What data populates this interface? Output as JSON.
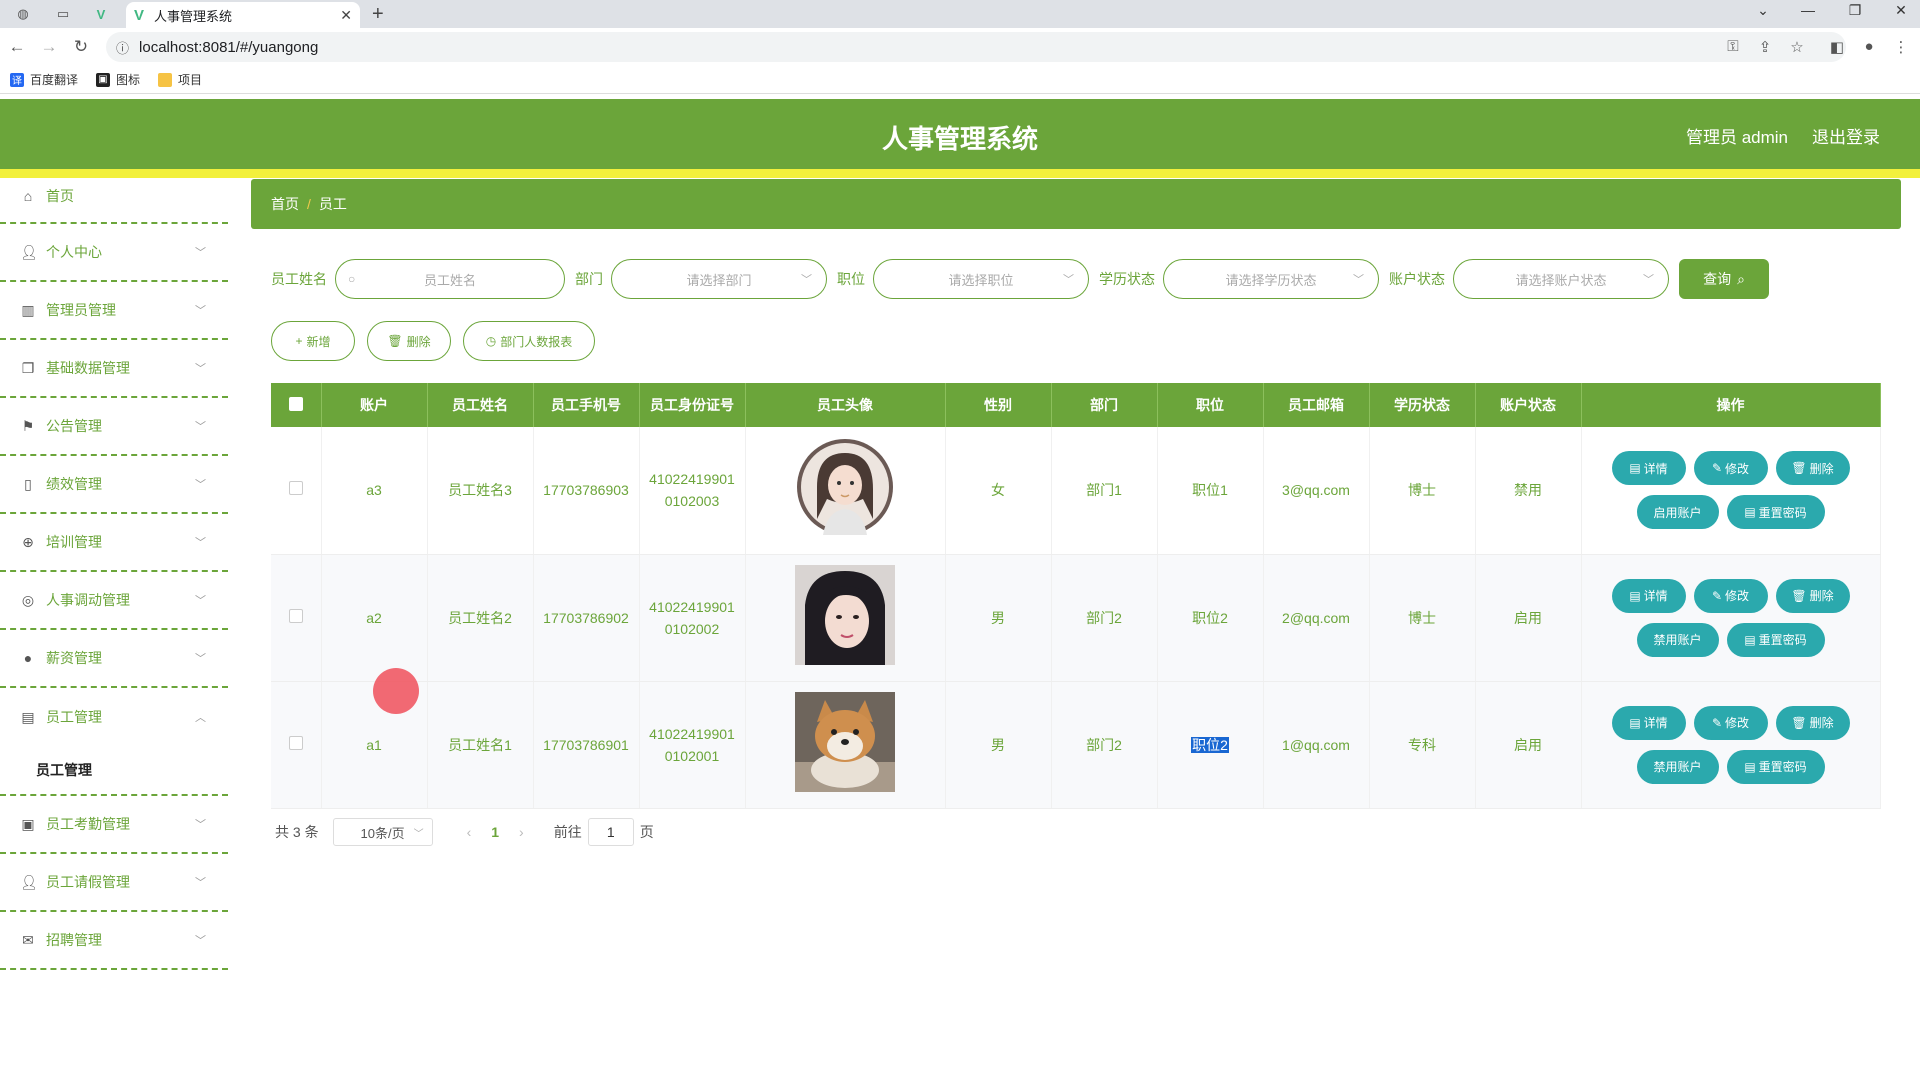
{
  "browser": {
    "tab_title": "人事管理系统",
    "url": "localhost:8081/#/yuangong",
    "bookmarks": [
      {
        "label": "百度翻译",
        "color": "#2468f2"
      },
      {
        "label": "图标",
        "color": "#222222"
      },
      {
        "label": "项目",
        "color": "#f6c344"
      }
    ]
  },
  "header": {
    "title": "人事管理系统",
    "admin_label": "管理员 admin",
    "logout_label": "退出登录"
  },
  "colors": {
    "brand_green": "#6ba53a",
    "accent_yellow": "#f2f03c",
    "teal_button": "#2ba9ad"
  },
  "sidebar": {
    "items": [
      {
        "label": "首页",
        "icon": "home-icon"
      },
      {
        "label": "个人中心",
        "icon": "user-icon"
      },
      {
        "label": "管理员管理",
        "icon": "bar-chart-icon"
      },
      {
        "label": "基础数据管理",
        "icon": "copy-icon"
      },
      {
        "label": "公告管理",
        "icon": "flag-icon"
      },
      {
        "label": "绩效管理",
        "icon": "mobile-icon"
      },
      {
        "label": "培训管理",
        "icon": "compass-icon"
      },
      {
        "label": "人事调动管理",
        "icon": "target-icon"
      },
      {
        "label": "薪资管理",
        "icon": "location-icon"
      },
      {
        "label": "员工管理",
        "icon": "cards-icon"
      },
      {
        "label": "员工考勤管理",
        "icon": "clipboard-icon"
      },
      {
        "label": "员工请假管理",
        "icon": "user-icon"
      },
      {
        "label": "招聘管理",
        "icon": "mail-icon"
      }
    ],
    "sub_active": "员工管理"
  },
  "breadcrumb": {
    "home": "首页",
    "separator": "/",
    "current": "员工"
  },
  "filters": {
    "name_label": "员工姓名",
    "name_placeholder": "员工姓名",
    "dept_label": "部门",
    "dept_placeholder": "请选择部门",
    "pos_label": "职位",
    "pos_placeholder": "请选择职位",
    "edu_label": "学历状态",
    "edu_placeholder": "请选择学历状态",
    "acct_label": "账户状态",
    "acct_placeholder": "请选择账户状态",
    "query_label": "查询"
  },
  "actions": {
    "add": "新增",
    "delete": "删除",
    "report": "部门人数报表"
  },
  "table": {
    "headers": [
      "账户",
      "员工姓名",
      "员工手机号",
      "员工身份证号",
      "员工头像",
      "性别",
      "部门",
      "职位",
      "员工邮箱",
      "学历状态",
      "账户状态",
      "操作"
    ],
    "rows": [
      {
        "account": "a3",
        "name": "员工姓名3",
        "phone": "17703786903",
        "id_card": "410224199010102003",
        "gender": "女",
        "dept": "部门1",
        "position": "职位1",
        "email": "3@qq.com",
        "edu": "博士",
        "status": "禁用",
        "toggle": "启用账户"
      },
      {
        "account": "a2",
        "name": "员工姓名2",
        "phone": "17703786902",
        "id_card": "410224199010102002",
        "gender": "男",
        "dept": "部门2",
        "position": "职位2",
        "email": "2@qq.com",
        "edu": "博士",
        "status": "启用",
        "toggle": "禁用账户"
      },
      {
        "account": "a1",
        "name": "员工姓名1",
        "phone": "17703786901",
        "id_card": "410224199010102001",
        "gender": "男",
        "dept": "部门2",
        "position": "职位2",
        "email": "1@qq.com",
        "edu": "专科",
        "status": "启用",
        "toggle": "禁用账户"
      }
    ],
    "op_detail": "详情",
    "op_edit": "修改",
    "op_delete": "删除",
    "op_reset": "重置密码"
  },
  "pagination": {
    "total": "共 3 条",
    "page_size": "10条/页",
    "current_page": "1",
    "goto_prefix": "前往",
    "goto_value": "1",
    "goto_suffix": "页"
  }
}
